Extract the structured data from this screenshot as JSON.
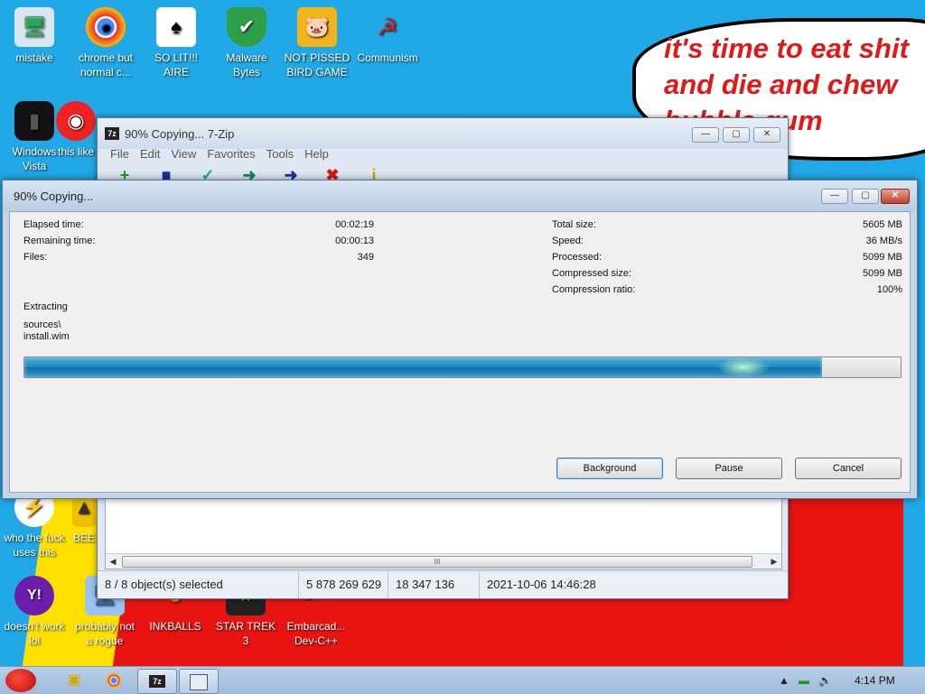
{
  "desktop": {
    "speech_text": "it's time to eat shit\nand die and chew\nbubble gum",
    "signature": "VM0b0t",
    "icons": [
      {
        "label": "mistake",
        "glyph": "🖥"
      },
      {
        "label": "chrome but normal c...",
        "glyph": "●"
      },
      {
        "label": "SO LIT!!! AIRE",
        "glyph": "♠"
      },
      {
        "label": "Malware Bytes",
        "glyph": "✔"
      },
      {
        "label": "NOT PISSED BIRD GAME",
        "glyph": "🐷"
      },
      {
        "label": "Communism",
        "glyph": "☭"
      },
      {
        "label": "Windows Vista",
        "glyph": "▮"
      },
      {
        "label": "this like",
        "glyph": "◉"
      },
      {
        "label": "who the fuck uses this",
        "glyph": "⚡"
      },
      {
        "label": "BEE",
        "glyph": "▲"
      },
      {
        "label": "doesn't work lol",
        "glyph": "Y!"
      },
      {
        "label": "probably not a rogue",
        "glyph": "🖥"
      },
      {
        "label": "INKBALLS",
        "glyph": "●"
      },
      {
        "label": "STAR TREK 3",
        "glyph": "★"
      },
      {
        "label": "Embarcad... Dev-C++",
        "glyph": "C++"
      }
    ]
  },
  "sevenzip": {
    "title": "90% Copying... 7-Zip",
    "app_icon": "7z",
    "menu": [
      "File",
      "Edit",
      "View",
      "Favorites",
      "Tools",
      "Help"
    ],
    "toolbar": [
      {
        "name": "add-icon",
        "glyph": "+",
        "color": "#19a319"
      },
      {
        "name": "extract-icon",
        "glyph": "■",
        "color": "#1a2ea6"
      },
      {
        "name": "test-icon",
        "glyph": "✓",
        "color": "#1aa6a6"
      },
      {
        "name": "copy-icon",
        "glyph": "➜",
        "color": "#18874d"
      },
      {
        "name": "move-icon",
        "glyph": "➜",
        "color": "#1a2ea6"
      },
      {
        "name": "delete-icon",
        "glyph": "✖",
        "color": "#d11a1a"
      },
      {
        "name": "info-icon",
        "glyph": "i",
        "color": "#c9a800"
      }
    ],
    "status": {
      "selected": "8 / 8 object(s) selected",
      "size": "5 878 269 629",
      "packed": "18 347 136",
      "date": "2021-10-06 14:46:28"
    },
    "scroll_grip": "III"
  },
  "copy_dialog": {
    "title": "90% Copying...",
    "left_stats": [
      {
        "label": "Elapsed time:",
        "value": "00:02:19"
      },
      {
        "label": "Remaining time:",
        "value": "00:00:13"
      },
      {
        "label": "Files:",
        "value": "349"
      }
    ],
    "right_stats": [
      {
        "label": "Total size:",
        "value": "5605 MB"
      },
      {
        "label": "Speed:",
        "value": "36 MB/s"
      },
      {
        "label": "Processed:",
        "value": "5099 MB"
      },
      {
        "label": "Compressed size:",
        "value": "5099 MB"
      },
      {
        "label": "Compression ratio:",
        "value": "100%"
      }
    ],
    "operation": "Extracting",
    "path_line1": "sources\\",
    "path_line2": "install.wim",
    "progress_fraction": 0.91,
    "buttons": {
      "background": "Background",
      "pause": "Pause",
      "cancel": "Cancel"
    },
    "caption_buttons": {
      "minimize": "—",
      "maximize": "▢",
      "close": "✕"
    }
  },
  "taskbar": {
    "clock": "4:14 PM",
    "tray": {
      "up": "▲",
      "network": "▬",
      "volume": "🔈"
    }
  }
}
